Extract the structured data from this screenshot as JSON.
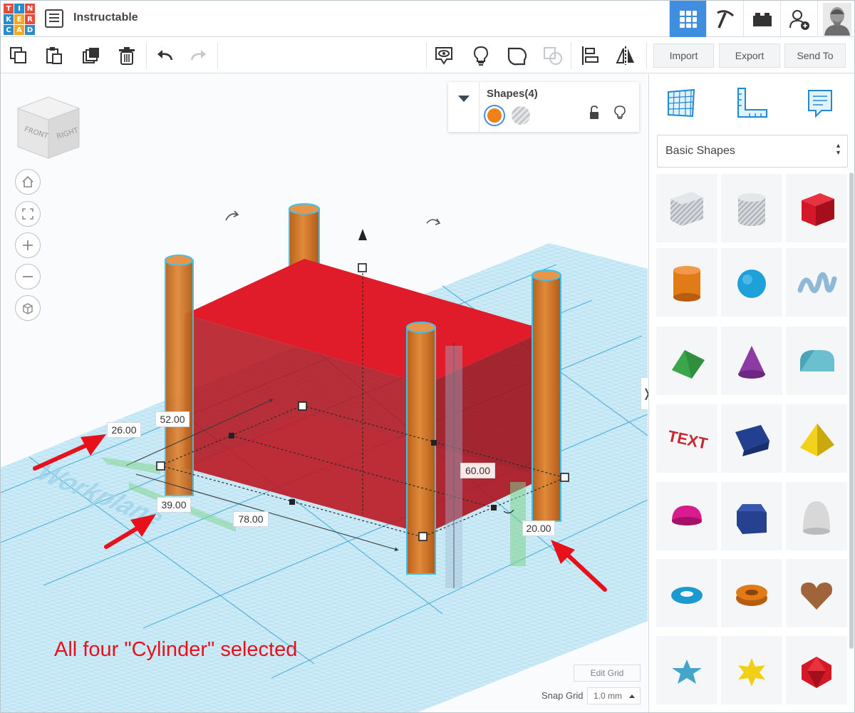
{
  "app": {
    "logo_letters": [
      "T",
      "I",
      "N",
      "K",
      "E",
      "R",
      "C",
      "A",
      "D"
    ],
    "logo_colors": [
      "#e84b3c",
      "#2e8bc9",
      "#e84b3c",
      "#2e8bc9",
      "#f2a71e",
      "#e84b3c",
      "#2e8bc9",
      "#f2a71e",
      "#2e8bc9"
    ],
    "design_title": "Instructable"
  },
  "top_tabs": [
    "grid-view-icon",
    "pickaxe-icon",
    "bricks-icon",
    "add-user-icon",
    "profile-avatar"
  ],
  "toolbar": {
    "tools": [
      "copy-icon",
      "paste-icon",
      "duplicate-icon",
      "trash-icon",
      "undo-icon",
      "redo-icon",
      "show-all-icon",
      "notes-icon",
      "group-icon",
      "ungroup-icon",
      "align-icon",
      "mirror-icon"
    ],
    "import_label": "Import",
    "export_label": "Export",
    "send_to_label": "Send To"
  },
  "view_cube": {
    "front_label": "FRONT",
    "right_label": "RIGHT"
  },
  "view_controls": [
    "home-icon",
    "fit-view-icon",
    "zoom-in-icon",
    "zoom-out-icon",
    "ortho-view-icon"
  ],
  "shapes_panel": {
    "title": "Shapes(4)",
    "solid_color": "#f0811a",
    "hole_color": "#c4c8cc"
  },
  "dimensions": {
    "length": "52.00",
    "pos_x": "26.00",
    "pos_y": "39.00",
    "width": "78.00",
    "height": "60.00",
    "elevation": "20.00"
  },
  "annotation": "All four \"Cylinder\" selected",
  "workplane_label": "Workplane",
  "grid": {
    "edit_label": "Edit Grid",
    "snap_label": "Snap Grid",
    "snap_value": "1.0 mm"
  },
  "colors": {
    "accent": "#3f8ee0",
    "box": "#e01c28",
    "cylinder": "#d97b2e",
    "highlight": "#4ac3e8",
    "workplane": "#bfe3f3",
    "arrow": "#e8111b"
  },
  "right_panel": {
    "tabs": [
      "workplane-grid-icon",
      "ruler-icon",
      "notes-panel-icon"
    ],
    "library": "Basic Shapes",
    "shapes": [
      {
        "name": "box-hole",
        "color": "#b7bcc2"
      },
      {
        "name": "cylinder-hole",
        "color": "#c0c4c9"
      },
      {
        "name": "box",
        "color": "#d3182a"
      },
      {
        "name": "cylinder",
        "color": "#e07b18"
      },
      {
        "name": "sphere",
        "color": "#1ea1d9"
      },
      {
        "name": "scribble",
        "color": "#8fb7d6"
      },
      {
        "name": "roof",
        "color": "#3aa64a"
      },
      {
        "name": "cone",
        "color": "#8e3aa5"
      },
      {
        "name": "round-roof",
        "color": "#6bc0cf"
      },
      {
        "name": "text",
        "color": "#c7272d"
      },
      {
        "name": "wedge",
        "color": "#233f8f"
      },
      {
        "name": "pyramid",
        "color": "#f2d21b"
      },
      {
        "name": "half-sphere",
        "color": "#d81b8e"
      },
      {
        "name": "polygon",
        "color": "#26418f"
      },
      {
        "name": "paraboloid",
        "color": "#d8d8d8"
      },
      {
        "name": "torus",
        "color": "#1a9ad1"
      },
      {
        "name": "tube",
        "color": "#e07b18"
      },
      {
        "name": "heart",
        "color": "#a0643a"
      },
      {
        "name": "star",
        "color": "#46a4c8"
      },
      {
        "name": "star-six",
        "color": "#f0cf15"
      },
      {
        "name": "icosahedron",
        "color": "#d3182a"
      }
    ]
  }
}
